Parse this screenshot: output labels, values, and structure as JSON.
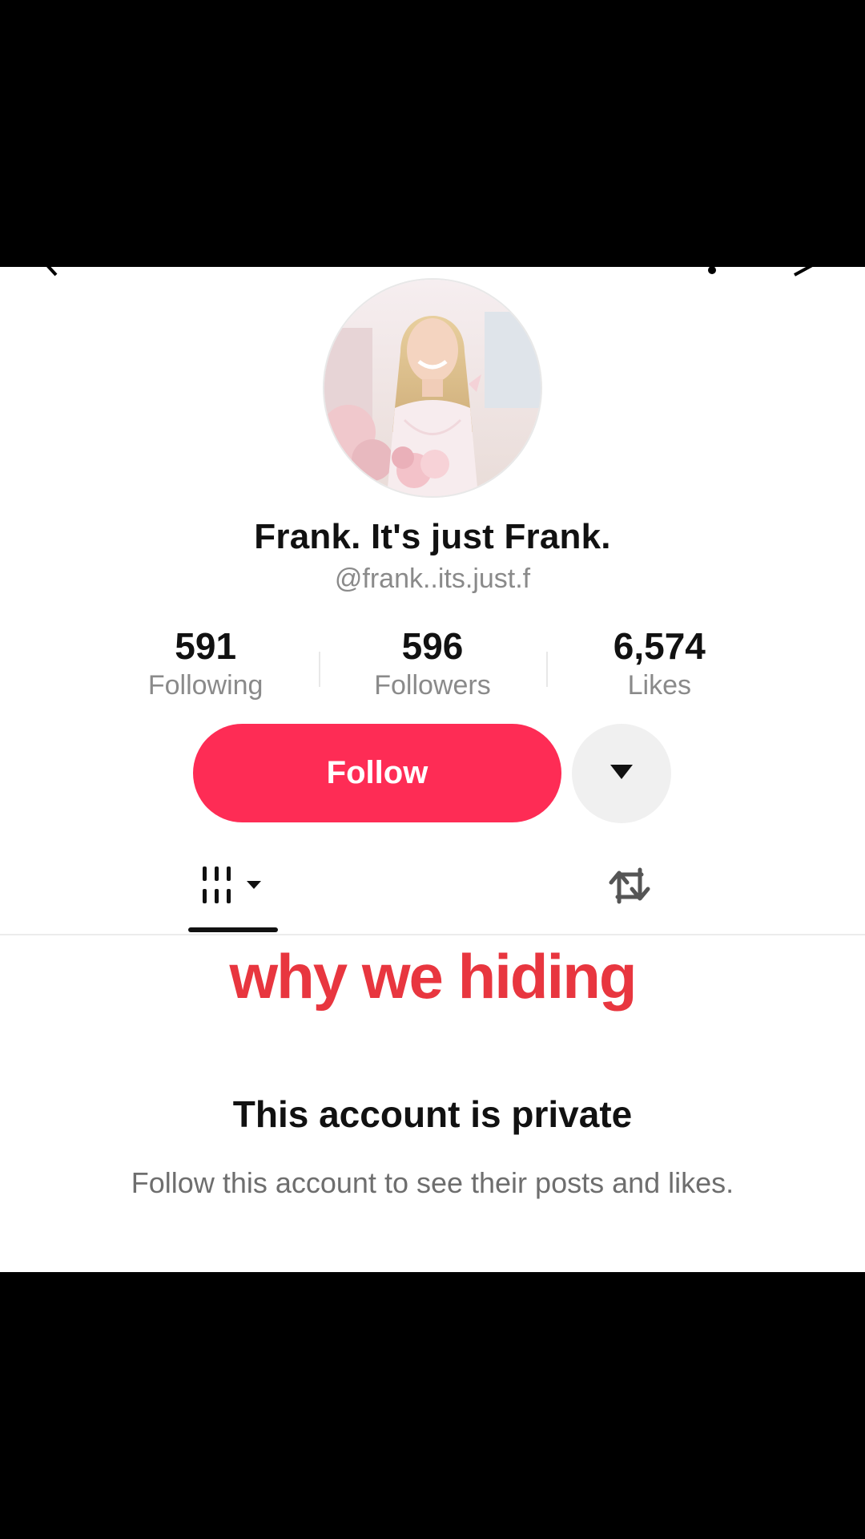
{
  "profile": {
    "display_name": "Frank. It's just Frank.",
    "handle": "@frank..its.just.f"
  },
  "stats": [
    {
      "value": "591",
      "label": "Following"
    },
    {
      "value": "596",
      "label": "Followers"
    },
    {
      "value": "6,574",
      "label": "Likes"
    }
  ],
  "actions": {
    "follow_label": "Follow",
    "dropdown_icon": "caret-down-icon"
  },
  "tabs": {
    "videos_icon": "grid-icon",
    "reposts_icon": "repost-icon"
  },
  "overlay": {
    "caption": "why we hiding"
  },
  "private": {
    "title": "This account is private",
    "description": "Follow this account to see their posts and likes."
  },
  "colors": {
    "accent": "#fe2c55",
    "caption": "#e8363f",
    "secondary_text": "#8a8a8a"
  }
}
